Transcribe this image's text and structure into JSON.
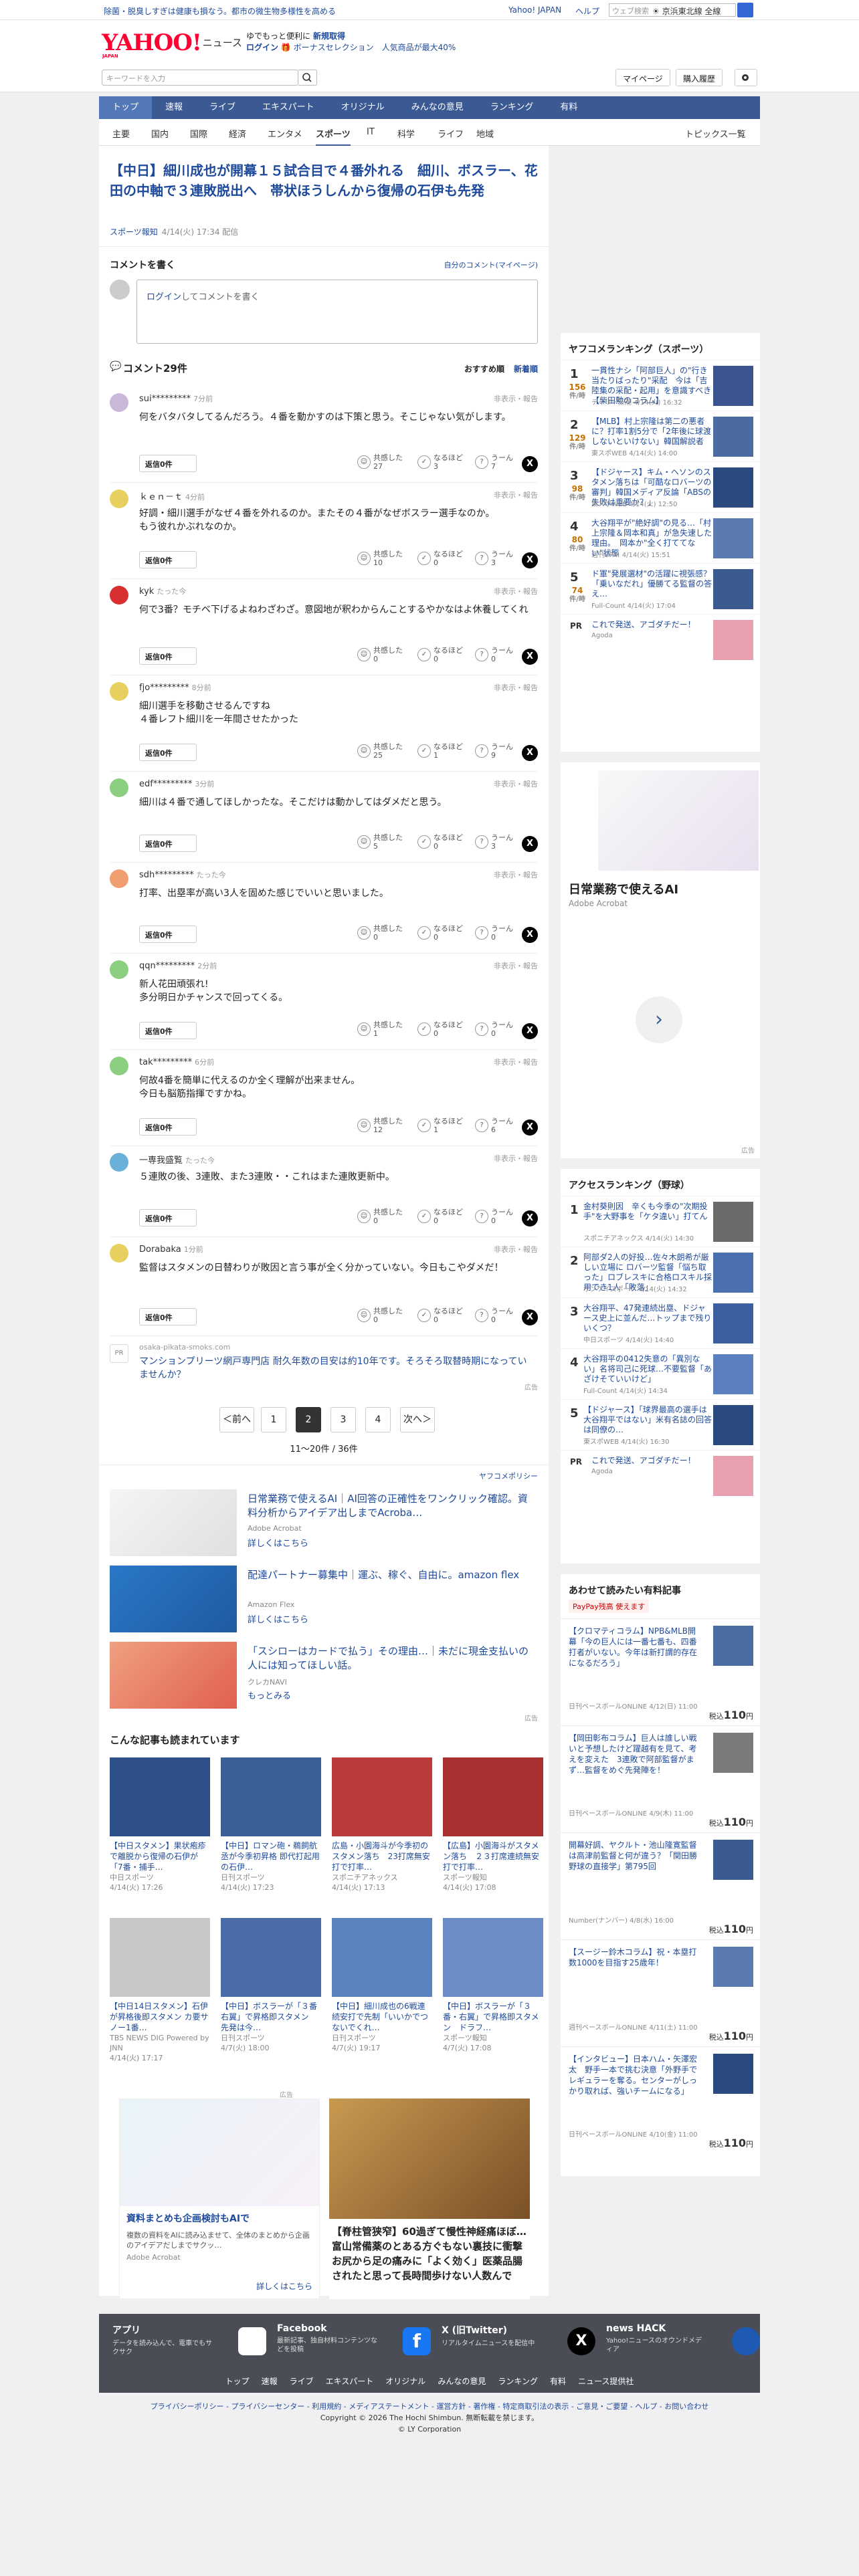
{
  "topbar": {
    "promo": "除菌・脱臭しすぎは健康も損なう。都市の微生物多様性を高める",
    "links": [
      "Yahoo! JAPAN",
      "ヘルプ"
    ],
    "search_placeholder": "ウェブ検索",
    "weather": "☀ 京浜東北線 全線"
  },
  "header": {
    "logo": "YAHOO!",
    "logo_sub": "JAPAN",
    "section": "ニュース",
    "promo1": "ゆでもっと便利に",
    "promo1b": "新規取得",
    "promo2": "ログイン",
    "promo2b": "🎁 ボーナスセレクション　人気商品が最大40%",
    "search_placeholder": "キーワードを入力",
    "mypage": "マイページ",
    "shopping": "購入履歴"
  },
  "nav1": [
    "トップ",
    "速報",
    "ライブ",
    "エキスパート",
    "オリジナル",
    "みんなの意見",
    "ランキング",
    "有料"
  ],
  "nav2": [
    "主要",
    "国内",
    "国際",
    "経済",
    "エンタメ",
    "スポーツ",
    "IT",
    "科学",
    "ライフ",
    "地域"
  ],
  "nav2_right": "トピックス一覧",
  "article": {
    "title": "【中日】細川成也が開幕１５試合目で４番外れる　細川、ボスラー、花田の中軸で３連敗脱出へ　帯状ほうしんから復帰の石伊も先発",
    "source": "スポーツ報知",
    "date": "4/14(火) 17:34 配信"
  },
  "comment_write": {
    "heading": "コメントを書く",
    "mine": "自分のコメント(マイページ)",
    "box_login": "ログイン",
    "box_text": "してコメントを書く"
  },
  "comments_head": {
    "title": "コメント29件",
    "sort_rec": "おすすめ順",
    "sort_new": "新着順"
  },
  "comments": [
    {
      "name": "sui*********",
      "time": "7分前",
      "report": "非表示・報告",
      "text": "何をバタバタしてるんだろう。４番を動かすのは下策と思う。そこじゃない気がします。",
      "reply": "返信0件",
      "like": "27",
      "ok": "3",
      "hmm": "7",
      "color": "#c9b8d8"
    },
    {
      "name": "ｋｅｎ－ｔ",
      "time": "4分前",
      "report": "非表示・報告",
      "text": "好調・細川選手がなぜ４番を外れるのか。またその４番がなぜボスラー選手なのか。\nもう彼れかぶれなのか。",
      "reply": "返信0件",
      "like": "10",
      "ok": "0",
      "hmm": "3",
      "color": "#e8d060"
    },
    {
      "name": "kyk",
      "time": "たった今",
      "report": "非表示・報告",
      "text": "何で3番？モチベ下げるよねわざわざ。意図地が釈わからんことするやかなはよ休養してくれ",
      "reply": "返信0件",
      "like": "0",
      "ok": "0",
      "hmm": "0",
      "color": "#d83030"
    },
    {
      "name": "fjo*********",
      "time": "8分前",
      "report": "非表示・報告",
      "text": "細川選手を移動させるんですね\n４番レフト細川を一年間させたかった",
      "reply": "返信0件",
      "like": "25",
      "ok": "1",
      "hmm": "9",
      "color": "#e8d060"
    },
    {
      "name": "edf*********",
      "time": "3分前",
      "report": "非表示・報告",
      "text": "細川は４番で通してほしかったな。そこだけは動かしてはダメだと思う。",
      "reply": "返信0件",
      "like": "5",
      "ok": "0",
      "hmm": "3",
      "color": "#8ccf80"
    },
    {
      "name": "sdh*********",
      "time": "たった今",
      "report": "非表示・報告",
      "text": "打率、出塁率が高い3人を固めた感じでいいと思いました。",
      "reply": "返信0件",
      "like": "0",
      "ok": "0",
      "hmm": "0",
      "color": "#f0a070"
    },
    {
      "name": "qqn*********",
      "time": "2分前",
      "report": "非表示・報告",
      "text": "新人花田頑張れ!\n多分明日かチャンスで回ってくる。",
      "reply": "返信0件",
      "like": "1",
      "ok": "0",
      "hmm": "0",
      "color": "#8ccf80"
    },
    {
      "name": "tak*********",
      "time": "6分前",
      "report": "非表示・報告",
      "text": "何故4番を簡単に代えるのか全く理解が出来ません。\n今日も脳筋指揮ですかね。",
      "reply": "返信0件",
      "like": "12",
      "ok": "1",
      "hmm": "6",
      "color": "#8ccf80"
    },
    {
      "name": "一専我盛覧",
      "time": "たった今",
      "report": "非表示・報告",
      "text": "５連敗の後、3連敗、また3連敗・・これはまた連敗更新中。",
      "reply": "返信0件",
      "like": "0",
      "ok": "0",
      "hmm": "0",
      "color": "#6bb0d8"
    },
    {
      "name": "Dorabaka",
      "time": "1分前",
      "report": "非表示・報告",
      "text": "監督はスタメンの日替わりが敗因と言う事が全く分かっていない。今日もこやダメだ！",
      "reply": "返信0件",
      "like": "0",
      "ok": "0",
      "hmm": "0",
      "color": "#e8d060"
    }
  ],
  "reactions": {
    "like": "共感した",
    "ok": "なるほど",
    "hmm": "うーん"
  },
  "comment_ad": {
    "url": "osaka-pikata-smoks.com",
    "title": "マンションプリーツ網戸専門店 耐久年数の目安は約10年です。そろそろ取替時期になっていませんか？",
    "label": "広告"
  },
  "pager": {
    "prev": "＜前へ",
    "pages": [
      "1",
      "2",
      "3",
      "4"
    ],
    "current": "2",
    "next": "次へ＞",
    "count": "11〜20件 / 36件"
  },
  "ads": {
    "policy": "ヤフコメポリシー",
    "items": [
      {
        "title": "日常業務で使えるAI｜AI回答の正確性をワンクリック確認。資料分析からアイデア出しまでAcroba…",
        "sponsor": "Adobe Acrobat",
        "more": "詳しくはこちら"
      },
      {
        "title": "配達パートナー募集中｜運ぶ、稼ぐ、自由に。amazon flex",
        "sponsor": "Amazon Flex",
        "more": "詳しくはこちら"
      },
      {
        "title": "「スシローはカードで払う」その理由…｜未だに現金支払いの人には知ってほしい話。",
        "sponsor": "クレカNAVI",
        "more": "もっとみる"
      }
    ],
    "label": "広告"
  },
  "reads": {
    "heading": "こんな記事も読まれています",
    "items": [
      {
        "title": "【中日スタメン】果状疱疹で離脱から復帰の石伊が「7番・捕手…",
        "src": "中日スポーツ",
        "date": "4/14(火) 17:26"
      },
      {
        "title": "【中日】ロマン砲・鵜飼航丞が今季初昇格 即代打起用の石伊…",
        "src": "日刊スポーツ",
        "date": "4/14(火) 17:23"
      },
      {
        "title": "広島・小園海斗が今季初のスタメン落ち　23打席無安打で打率…",
        "src": "スポニチアネックス",
        "date": "4/14(火) 17:13"
      },
      {
        "title": "【広島】小園海斗がスタメン落ち　２３打席連続無安打で打率…",
        "src": "スポーツ報知",
        "date": "4/14(火) 17:08"
      },
      {
        "title": "【中日14日スタメン】石伊が昇格後即スタメン カ要サノー1番…",
        "src": "TBS NEWS DIG Powered by JNN",
        "date": "4/14(火) 17:17"
      },
      {
        "title": "【中日】ボスラーが「３番右翼」で昇格即スタメン　先発は今…",
        "src": "日刊スポーツ",
        "date": "4/7(火) 18:00"
      },
      {
        "title": "【中日】細川成也の6戦連続安打で先制「いいかでつないでくれ…",
        "src": "日刊スポーツ",
        "date": "4/7(火) 19:17"
      },
      {
        "title": "【中日】ボスラーが「３番・右翼」で昇格即スタメン　ドラフ…",
        "src": "スポーツ報知",
        "date": "4/7(火) 17:08"
      }
    ]
  },
  "bottom_ads": {
    "label": "広告",
    "a1_title": "資料まとめも企画検討もAIで",
    "a1_desc": "複数の資料をAIに読み込ませて、全体のまとめから企画のアイデアだしまでサクッ…",
    "a1_sponsor": "Adobe Acrobat",
    "a1_more": "詳しくはこちら",
    "a2_title": "【脊柱管狭窄】60過ぎて慢性神経痛ほぼ…富山常備薬のとある方ぐもない裏技に衝撃お尻から足の痛みに「よく効く」医薬品腸されたと思って長時間歩けない人数んで"
  },
  "rank": {
    "heading": "ヤフコメランキング（スポーツ）",
    "items": [
      {
        "n": "1",
        "count": "156",
        "unit": "件/時",
        "title": "一貫性ナシ「阿部巨人」の\"行き当たりばったり\"采配　今は「吉陸集の采配・起用」を意識すべき【柴田勲のコラム】",
        "src": "デイリー新潮 4/14(火) 16:32"
      },
      {
        "n": "2",
        "count": "129",
        "unit": "件/時",
        "title": "【MLB】村上宗隆は第二の悪者に？打率1割5分で「2年後に球渡しないといけない」韓国解説者",
        "src": "東スポWEB 4/14(火) 14:00"
      },
      {
        "n": "3",
        "count": "98",
        "unit": "件/時",
        "title": "【ドジャース】キム・ヘソンのスタメン落ちは「可酷なロバーツの審判」韓国メディア反論「ABSの失敗は重要か？」",
        "src": "東スポWEB 4/14(火) 12:50"
      },
      {
        "n": "4",
        "count": "80",
        "unit": "件/時",
        "title": "大谷翔平が\"絶好調\"の見る…「村上宗隆＆岡本和真」が急失速した理由。　岡本か\"全く打ててない\"状態",
        "src": "週刊SPA! 4/14(火) 15:51"
      },
      {
        "n": "5",
        "count": "74",
        "unit": "件/時",
        "title": "ド軍\"発展選材\"の活躍に視張感？「乗いなだれ」優勝てる監督の答え…",
        "src": "Full-Count 4/14(火) 17:04"
      }
    ],
    "pr_title": "これで発送、アゴダチだー！",
    "pr_src": "Agoda",
    "pr": "PR"
  },
  "side_ad": {
    "title": "日常業務で使えるAI",
    "sponsor": "Adobe Acrobat",
    "label": "広告"
  },
  "access": {
    "heading": "アクセスランキング（野球）",
    "items": [
      {
        "n": "1",
        "title": "金村葵則因　辛くも今季の\"次期投手\"を大野事を「ケタ違い」打てん",
        "src": "スポニチアネックス 4/14(火) 14:30"
      },
      {
        "n": "2",
        "title": "阿部ダ2人の好投…佐々木朗希が厳しい立場に ロバーツ監督「悩ち取った」ロブレスキに合格ロスキル採用でき1人「敗落」",
        "src": "サンケイスポーツ 4/14(火) 14:32"
      },
      {
        "n": "3",
        "title": "大谷翔平、47発連続出塁、ドジャース史上に並んだ…トップまで残りいくつ？",
        "src": "中日スポーツ 4/14(火) 14:40"
      },
      {
        "n": "4",
        "title": "大谷翔平の0412失意の「異別ない」名将司己に死球…不要監督「あざけそていいけど」",
        "src": "Full-Count 4/14(火) 14:34"
      },
      {
        "n": "5",
        "title": "【ドジャース】「球界最高の選手は大谷翔平ではない」米有名誌の回答は同僚の…",
        "src": "東スポWEB 4/14(火) 16:30"
      }
    ],
    "pr_title": "これで発送、アゴダチだー！",
    "pr_src": "Agoda",
    "pr": "PR"
  },
  "paid": {
    "heading": "あわせて読みたい有料記事",
    "badge": "PayPay残高 使えます",
    "items": [
      {
        "title": "【クロマティコラム】NPB&MLB開幕「今の巨人には一番七番も、四番打者がいない。今年は新打謂的存在になるだろう」",
        "src": "日刊ベースボールONLINE 4/12(日) 11:00",
        "price": "110",
        "unit": "税込"
      },
      {
        "title": "【岡田彰布コラム】巨人は誰しい戦いと予想したけど躍越有を見て、考えを変えた　3連敗で阿部監督がまず…監督をめぐ先発陣を！",
        "src": "日刊ベースボールONLINE 4/9(木) 11:00",
        "price": "110",
        "unit": "税込"
      },
      {
        "title": "開幕好調、ヤクルト・池山隆寛監督は高津前監督と何が違う？「関田勝　野球の直接学」第795回",
        "src": "Number(ナンバー) 4/8(水) 16:00",
        "price": "110",
        "unit": "税込"
      },
      {
        "title": "【スージー鈴木コラム】祝・本塁打数1000を目指す25歳年！",
        "src": "週刊ベースボールONLINE 4/11(土) 11:00",
        "price": "110",
        "unit": "税込"
      },
      {
        "title": "【インタビュー】日本ハム・矢澤宏太　野手一本で挑む決意「外野手でレギュラーを奪る。センターがしっかり取れば、強いチームになる」",
        "src": "日刊ベースボールONLINE 4/10(金) 11:00",
        "price": "110",
        "unit": "税込"
      }
    ],
    "price_symbol": "円"
  },
  "footer": {
    "app_h": "アプリ",
    "app_d": "データを読み込んで、電車でもサクサク",
    "fb_h": "Facebook",
    "fb_d": "最新記事、独自材料コンテンツなどを投稿",
    "x_h": "X (旧Twitter)",
    "x_d": "リアルタイムニュースを配信中",
    "hack_h": "news HACK",
    "hack_d": "Yahoo!ニュースのオウンドメディア",
    "nav": [
      "トップ",
      "速報",
      "ライブ",
      "エキスパート",
      "オリジナル",
      "みんなの意見",
      "ランキング",
      "有料",
      "ニュース提供社"
    ]
  },
  "copyright": {
    "links": "プライバシーポリシー - プライバシーセンター - 利用規約 - メディアステートメント - 運営方針 - 著作権 - 特定商取引法の表示 - ご意見・ご要望 - ヘルプ - お問い合わせ",
    "line1": "Copyright © 2026 The Hochi Shimbun. 無断転載を禁じます。",
    "line2": "© LY Corporation"
  }
}
